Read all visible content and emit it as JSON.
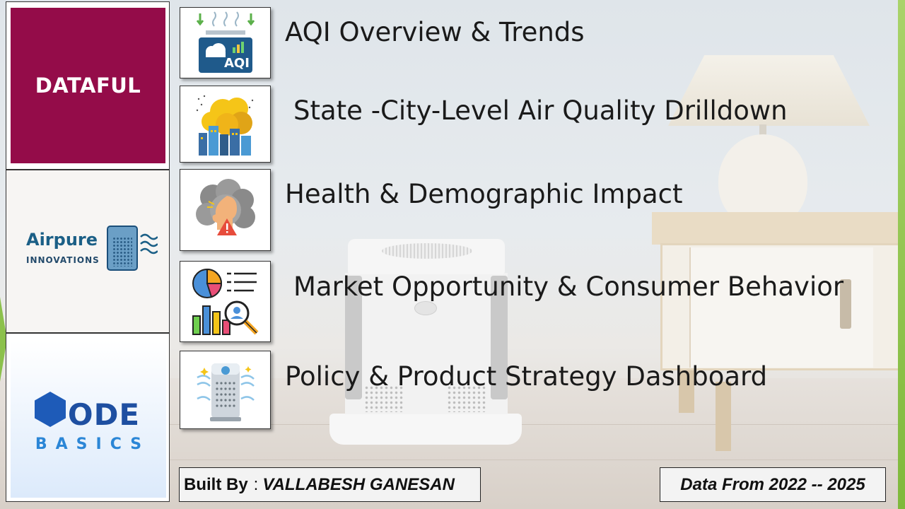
{
  "logos": {
    "dataful": "DATAFUL",
    "airpure": {
      "name": "Airpure",
      "sub": "INNOVATIONS"
    },
    "code_basics": {
      "word": "ODE",
      "sub": "BASICS"
    }
  },
  "menu": [
    {
      "label": "AQI Overview & Trends",
      "icon": "aqi-monitor-icon"
    },
    {
      "label": "State -City-Level Air Quality Drilldown",
      "icon": "polluted-city-icon"
    },
    {
      "label": "Health & Demographic Impact",
      "icon": "health-warning-icon"
    },
    {
      "label": "Market Opportunity & Consumer Behavior",
      "icon": "market-analytics-icon"
    },
    {
      "label": "Policy & Product Strategy Dashboard",
      "icon": "air-purifier-icon"
    }
  ],
  "footer": {
    "built_by_label": "Built By",
    "built_by_sep": ":",
    "built_by_name": "VALLABESH GANESAN",
    "data_range": "Data From 2022 -- 2025"
  },
  "colors": {
    "dataful_bg": "#940c49",
    "airpure_blue": "#1b5f86",
    "code_blue": "#1e4fa1",
    "accent_green": "#8cc14c"
  }
}
